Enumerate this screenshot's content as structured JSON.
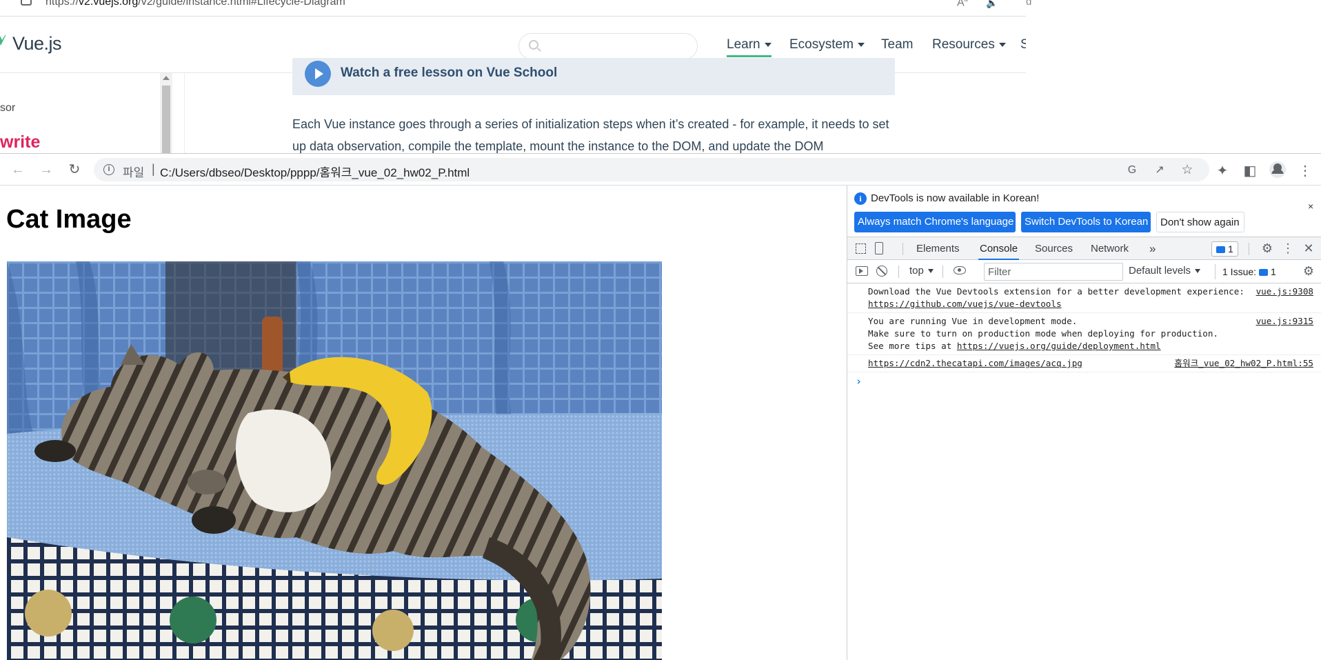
{
  "background_browser": {
    "address": {
      "scheme": "https://",
      "host": "v2.vuejs.org",
      "path": "/v2/guide/instance.html#Lifecycle-Diagram"
    },
    "read_aloud_label": "Aᴬ",
    "speaker_label": "☰",
    "right_stub_text": "d",
    "site": {
      "brand": "Vue.js",
      "search_placeholder": "",
      "nav": {
        "learn": "Learn",
        "ecosystem": "Ecosystem",
        "team": "Team",
        "resources": "Resources",
        "cut_off": "S"
      },
      "sidebar": {
        "item_partial": "sor",
        "sponsor_partial": "write"
      },
      "promo_text": "Watch a free lesson on Vue School",
      "paragraph": "Each Vue instance goes through a series of initialization steps when it’s created - for example, it needs to set up data observation, compile the template, mount the instance to the DOM, and update the DOM"
    }
  },
  "browser": {
    "nav": {
      "back": "←",
      "forward": "→",
      "reload": "↻"
    },
    "omnibox": {
      "scheme_label": "파일",
      "separator": "|",
      "url": "C:/Users/dbseo/Desktop/pppp/홈워크_vue_02_hw02_P.html"
    },
    "icons": [
      "translate-icon",
      "share-icon",
      "star-icon",
      "extensions-icon",
      "side-panel-icon",
      "profile-icon",
      "menu-icon"
    ],
    "glyphs": {
      "translate": "G",
      "share": "↗",
      "star": "☆",
      "extensions": "✦",
      "side_panel": "◧",
      "menu": "⋮"
    }
  },
  "page": {
    "title": "Cat Image",
    "image_alt": "cat sleeping with banana"
  },
  "devtools": {
    "infobar": {
      "message": "DevTools is now available in Korean!",
      "match_button": "Always match Chrome's language",
      "switch_button": "Switch DevTools to Korean",
      "dont_show_button": "Don't show again",
      "close_glyph": "×"
    },
    "tabs": {
      "elements": "Elements",
      "console": "Console",
      "sources": "Sources",
      "network": "Network",
      "more": "»"
    },
    "issues_badge": "1",
    "glyphs": {
      "gear": "⚙",
      "kebab": "⋮",
      "close": "✕"
    },
    "console_toolbar": {
      "context": "top",
      "filter_placeholder": "Filter",
      "levels": "Default levels",
      "issue_label": "1 Issue:",
      "issue_count": "1"
    },
    "messages": [
      {
        "text": "Download the Vue Devtools extension for a better development experience:",
        "link": "https://github.com/vuejs/vue-devtools",
        "source": "vue.js:9308"
      },
      {
        "text": "You are running Vue in development mode.\nMake sure to turn on production mode when deploying for production.\nSee more tips at ",
        "link": "https://vuejs.org/guide/deployment.html",
        "source": "vue.js:9315"
      },
      {
        "text": "",
        "link": "https://cdn2.thecatapi.com/images/acq.jpg",
        "source": "홈워크_vue_02_hw02_P.html:55"
      }
    ],
    "prompt_glyph": "›"
  },
  "colors": {
    "vue_green": "#42b983",
    "chrome_blue": "#1a73e8",
    "sponsor_pink": "#e0245e",
    "promo_bg": "#e7ecf3"
  }
}
